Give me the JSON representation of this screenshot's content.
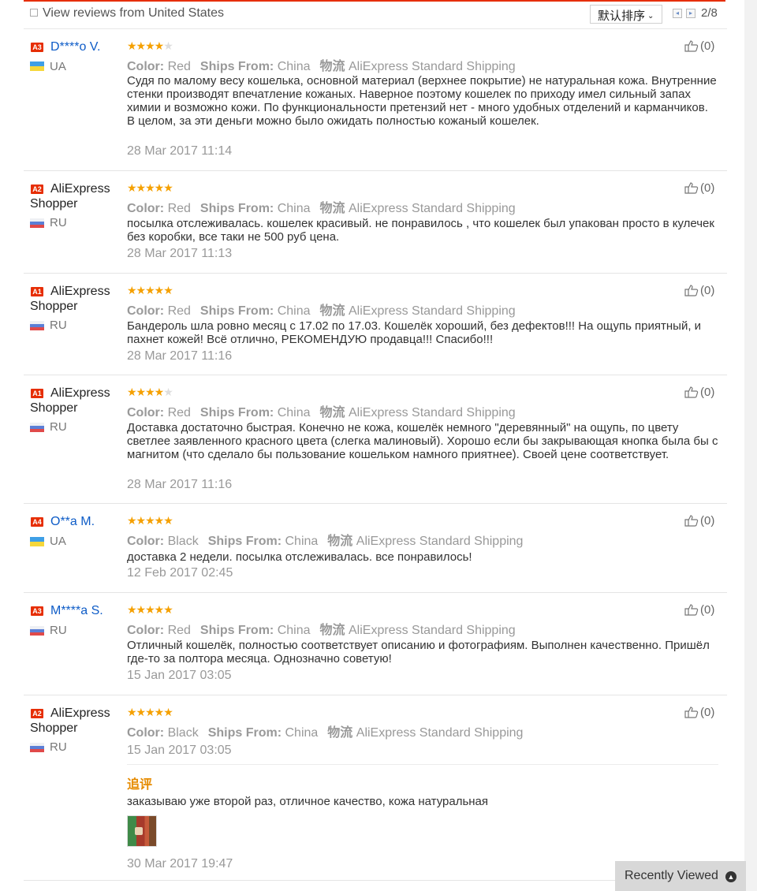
{
  "filter": {
    "checkbox_label": "View reviews from United States",
    "sort_label": "默认排序",
    "pager_text": "2/8",
    "prev_symbol": "◂",
    "next_symbol": "▸"
  },
  "labels": {
    "color": "Color:",
    "ships_from": "Ships From:",
    "shipping_cn": "物流",
    "additional": "追评"
  },
  "reviews": [
    {
      "badge": "A3",
      "user": "D****o V.",
      "country": "UA",
      "stars": 4,
      "color": "Red",
      "ships_from": "China",
      "shipping": "AliExpress Standard Shipping",
      "text": "Судя по малому весу кошелька, основной материал (верхнее покрытие) не натуральная кожа. Внутренние стенки производят впечатление кожаных. Наверное поэтому кошелек по приходу имел сильный запах химии и возможно кожи. По функциональности претензий нет - много удобных отделений и карманчиков. В целом, за эти деньги можно было ожидать полностью кожаный кошелек.",
      "date": "28 Mar 2017 11:14",
      "helpful": "(0)"
    },
    {
      "badge": "A2",
      "user": "AliExpress Shopper",
      "country": "RU",
      "stars": 5,
      "color": "Red",
      "ships_from": "China",
      "shipping": "AliExpress Standard Shipping",
      "text": "посылка отслеживалась. кошелек красивый. не понравилось , что кошелек был упакован просто в кулечек без коробки, все таки не 500 руб цена.",
      "date": "28 Mar 2017 11:13",
      "helpful": "(0)"
    },
    {
      "badge": "A1",
      "user": "AliExpress Shopper",
      "country": "RU",
      "stars": 5,
      "color": "Red",
      "ships_from": "China",
      "shipping": "AliExpress Standard Shipping",
      "text": "Бандероль шла ровно месяц с 17.02 по 17.03. Кошелёк хороший, без дефектов!!! На ощупь приятный, и пахнет кожей! Всё отлично, РЕКОМЕНДУЮ продавца!!! Спасибо!!!",
      "date": "28 Mar 2017 11:16",
      "helpful": "(0)"
    },
    {
      "badge": "A1",
      "user": "AliExpress Shopper",
      "country": "RU",
      "stars": 4,
      "color": "Red",
      "ships_from": "China",
      "shipping": "AliExpress Standard Shipping",
      "text": "Доставка достаточно быстрая. Конечно не кожа, кошелёк немного \"деревянный\" на ощупь, по цвету светлее заявленного красного цвета (слегка малиновый). Хорошо если бы закрывающая кнопка была бы с магнитом (что сделало бы пользование кошельком намного приятнее). Своей цене соответствует.",
      "date": "28 Mar 2017 11:16",
      "helpful": "(0)"
    },
    {
      "badge": "A4",
      "user": "O**a M.",
      "country": "UA",
      "stars": 5,
      "color": "Black",
      "ships_from": "China",
      "shipping": "AliExpress Standard Shipping",
      "text": "доставка 2 недели. посылка отслеживалась. все понравилось!",
      "date": "12 Feb 2017 02:45",
      "helpful": "(0)"
    },
    {
      "badge": "A3",
      "user": "M****a S.",
      "country": "RU",
      "stars": 5,
      "color": "Red",
      "ships_from": "China",
      "shipping": "AliExpress Standard Shipping",
      "text": "Отличный кошелёк, полностью соответствует описанию и фотографиям. Выполнен качественно. Пришёл где-то за полтора месяца. Однозначно советую!",
      "date": "15 Jan 2017 03:05",
      "helpful": "(0)"
    },
    {
      "badge": "A2",
      "user": "AliExpress Shopper",
      "country": "RU",
      "stars": 5,
      "color": "Black",
      "ships_from": "China",
      "shipping": "AliExpress Standard Shipping",
      "text": "",
      "date": "15 Jan 2017 03:05",
      "helpful": "(0)",
      "additional_text": "заказываю уже второй раз, отличное качество, кожа натуральная",
      "additional_date": "30 Mar 2017 19:47"
    }
  ],
  "recently_viewed": {
    "label": "Recently Viewed",
    "icon": "chevron-up-icon"
  },
  "colors": {
    "accent": "#e62e04",
    "star": "#f5a000",
    "link": "#0e5cc7",
    "additional": "#e68b00"
  }
}
